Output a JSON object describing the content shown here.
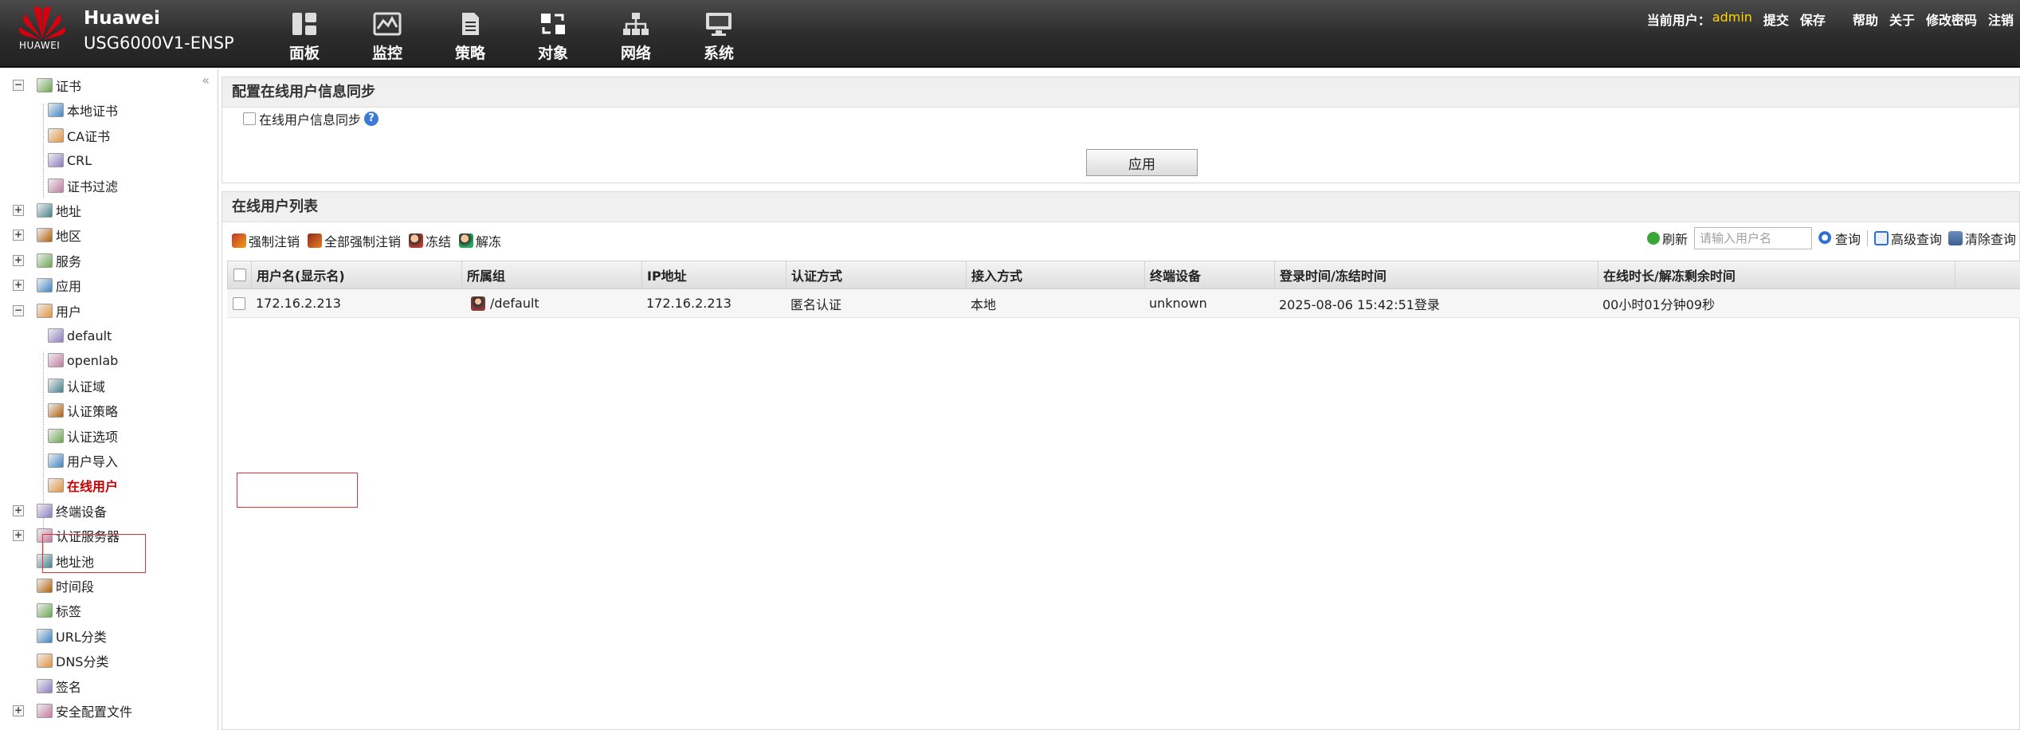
{
  "header": {
    "brand_line1": "Huawei",
    "brand_line2": "USG6000V1-ENSP",
    "logo_text": "HUAWEI",
    "nav": [
      {
        "label": "面板",
        "icon": "dashboard-icon"
      },
      {
        "label": "监控",
        "icon": "monitor-icon"
      },
      {
        "label": "策略",
        "icon": "policy-icon"
      },
      {
        "label": "对象",
        "icon": "object-icon"
      },
      {
        "label": "网络",
        "icon": "network-icon"
      },
      {
        "label": "系统",
        "icon": "system-icon"
      }
    ],
    "current_user_label": "当前用户：",
    "current_user": "admin",
    "links": [
      "提交",
      "保存",
      "帮助",
      "关于",
      "修改密码",
      "注销"
    ]
  },
  "sidebar": {
    "items": [
      {
        "label": "证书",
        "level": 0,
        "expander": "−"
      },
      {
        "label": "本地证书",
        "level": 1
      },
      {
        "label": "CA证书",
        "level": 1
      },
      {
        "label": "CRL",
        "level": 1
      },
      {
        "label": "证书过滤",
        "level": 1
      },
      {
        "label": "地址",
        "level": 0,
        "expander": "+"
      },
      {
        "label": "地区",
        "level": 0,
        "expander": "+"
      },
      {
        "label": "服务",
        "level": 0,
        "expander": "+"
      },
      {
        "label": "应用",
        "level": 0,
        "expander": "+"
      },
      {
        "label": "用户",
        "level": 0,
        "expander": "−"
      },
      {
        "label": "default",
        "level": 1
      },
      {
        "label": "openlab",
        "level": 1
      },
      {
        "label": "认证域",
        "level": 1
      },
      {
        "label": "认证策略",
        "level": 1
      },
      {
        "label": "认证选项",
        "level": 1
      },
      {
        "label": "用户导入",
        "level": 1
      },
      {
        "label": "在线用户",
        "level": 1,
        "selected": true
      },
      {
        "label": "终端设备",
        "level": 0,
        "expander": "+"
      },
      {
        "label": "认证服务器",
        "level": 0,
        "expander": "+"
      },
      {
        "label": "地址池",
        "level": 0
      },
      {
        "label": "时间段",
        "level": 0
      },
      {
        "label": "标签",
        "level": 0
      },
      {
        "label": "URL分类",
        "level": 0
      },
      {
        "label": "DNS分类",
        "level": 0
      },
      {
        "label": "签名",
        "level": 0
      },
      {
        "label": "安全配置文件",
        "level": 0,
        "expander": "+"
      }
    ]
  },
  "sync_panel": {
    "title": "配置在线用户信息同步",
    "checkbox_label": "在线用户信息同步",
    "help": "?",
    "apply_label": "应用"
  },
  "list_panel": {
    "title": "在线用户列表",
    "toolbar": [
      {
        "label": "强制注销",
        "icon": "force-logout-icon"
      },
      {
        "label": "全部强制注销",
        "icon": "force-logout-all-icon"
      },
      {
        "label": "冻结",
        "icon": "freeze-icon"
      },
      {
        "label": "解冻",
        "icon": "unfreeze-icon"
      }
    ],
    "refresh_label": "刷新",
    "search_placeholder": "请输入用户名",
    "query_label": "查询",
    "advanced_query_label": "高级查询",
    "clear_query_label": "清除查询",
    "columns": [
      "用户名(显示名)",
      "所属组",
      "IP地址",
      "认证方式",
      "接入方式",
      "终端设备",
      "登录时间/冻结时间",
      "在线时长/解冻剩余时间"
    ],
    "rows": [
      {
        "username": "172.16.2.213",
        "group": "/default",
        "ip": "172.16.2.213",
        "auth_method": "匿名认证",
        "access_method": "本地",
        "terminal": "unknown",
        "login_time": "2025-08-06 15:42:51登录",
        "duration": "00小时01分钟09秒"
      }
    ]
  },
  "colors": {
    "header_bg": "#2c2c2c",
    "user_highlight": "#ffd700",
    "highlight_box": "#e0313b",
    "huawei_red": "#d7000f"
  }
}
